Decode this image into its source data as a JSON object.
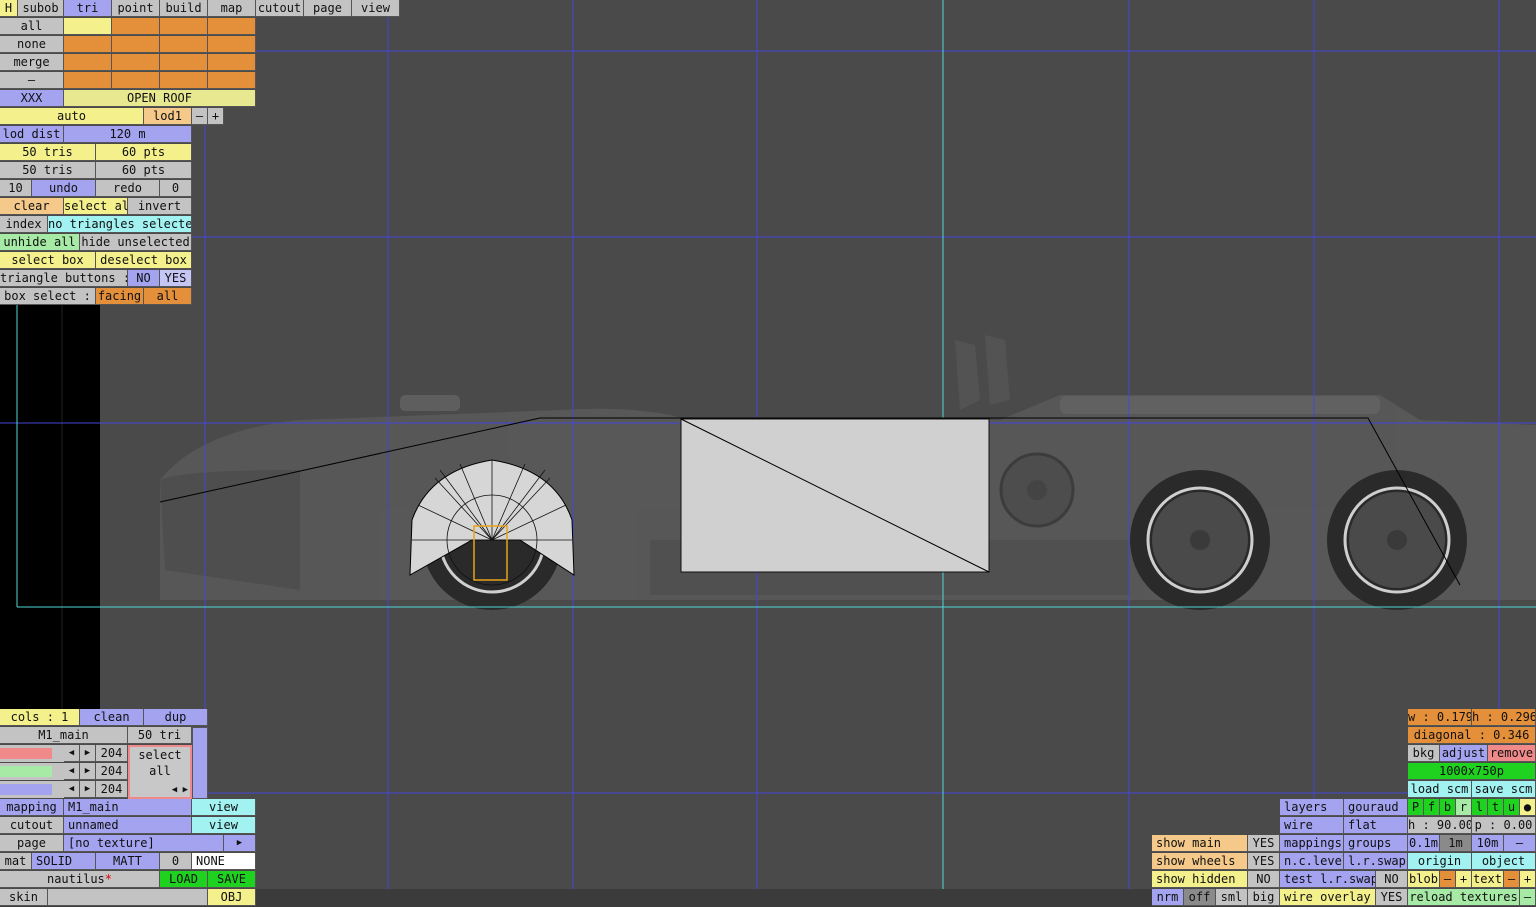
{
  "colors": {
    "bg": "#4a4a4a",
    "grid": "#4646d8",
    "axis": "#4fd6d6",
    "panel_gray": "#c3c3c3",
    "blue": "#a3a3f0",
    "yellow": "#f4f08c",
    "orange": "#e48f3a",
    "cyan": "#a2f2f2",
    "green": "#1fd21f"
  },
  "menu": {
    "h": "H",
    "tabs": [
      "subob",
      "tri",
      "point",
      "build",
      "map",
      "cutout",
      "page",
      "view"
    ]
  },
  "subob": {
    "rows": [
      "all",
      "none",
      "merge",
      "–"
    ],
    "xxx": "XXX",
    "open_roof": "OPEN ROOF"
  },
  "lod": {
    "auto": "auto",
    "lod1": "lod1",
    "minus": "–",
    "plus": "+",
    "dist_label": "lod dist",
    "dist_value": "120 m"
  },
  "stats": {
    "tris1": "50 tris",
    "pts1": "60 pts",
    "tris2": "50 tris",
    "pts2": "60 pts"
  },
  "undo": {
    "count": "10",
    "undo": "undo",
    "redo": "redo",
    "redo_count": "0"
  },
  "select": {
    "clear": "clear",
    "select_all": "select all",
    "invert": "invert",
    "index": "index",
    "status": "no triangles selected",
    "unhide_all": "unhide all",
    "hide_unselected": "hide unselected",
    "select_box": "select box",
    "deselect_box": "deselect box",
    "tri_buttons": "triangle buttons :",
    "no": "NO",
    "yes": "YES",
    "box_select": "box select :",
    "facing": "facing",
    "all": "all"
  },
  "mat": {
    "cols": "cols : 1",
    "clean": "clean",
    "dup": "dup",
    "name": "M1_main",
    "tri_count": "50 tri",
    "rgb": [
      "204",
      "204",
      "204"
    ],
    "select_all": "select all",
    "mapping_label": "mapping",
    "mapping_value": "M1_main",
    "view1": "view",
    "cutout_label": "cutout",
    "cutout_value": "unnamed",
    "view2": "view",
    "page_label": "page",
    "page_value": "[no texture]",
    "play": "▶",
    "mat_label": "mat",
    "solid": "SOLID",
    "matt": "MATT",
    "zero": "0",
    "none": "NONE",
    "nautilus": "nautilus",
    "star": "*",
    "load": "LOAD",
    "save": "SAVE",
    "skin": "skin",
    "obj": "OBJ"
  },
  "show": {
    "main": "show main",
    "main_v": "YES",
    "wheels": "show wheels",
    "wheels_v": "YES",
    "hidden": "show hidden",
    "hidden_v": "NO",
    "nrm": "nrm",
    "off": "off",
    "sml": "sml",
    "big": "big"
  },
  "layers": {
    "layers": "layers",
    "gouraud": "gouraud",
    "wire": "wire",
    "flat": "flat",
    "mappings": "mappings",
    "groups": "groups",
    "nclevel": "n.c.level",
    "lrswap": "l.r.swap",
    "test": "test l.r.swap",
    "test_v": "NO",
    "overlay": "wire overlay",
    "overlay_v": "YES"
  },
  "right": {
    "w": "w : 0.179",
    "h": "h : 0.296",
    "diag": "diagonal : 0.346",
    "bkg": "bkg",
    "adjust": "adjust",
    "remove": "remove",
    "res": "1000x750p",
    "load_scm": "load scm",
    "save_scm": "save scm",
    "views": [
      "P",
      "f",
      "b",
      "r",
      "l",
      "t",
      "u",
      "●"
    ],
    "hval": "h : 90.00",
    "pval": "p : 0.00",
    "steps": [
      "0.1m",
      "1m",
      "10m",
      "–"
    ],
    "origin": "origin",
    "object": "object",
    "blob": "blob",
    "text": "text",
    "minus": "–",
    "plus": "+",
    "reload": "reload textures"
  }
}
